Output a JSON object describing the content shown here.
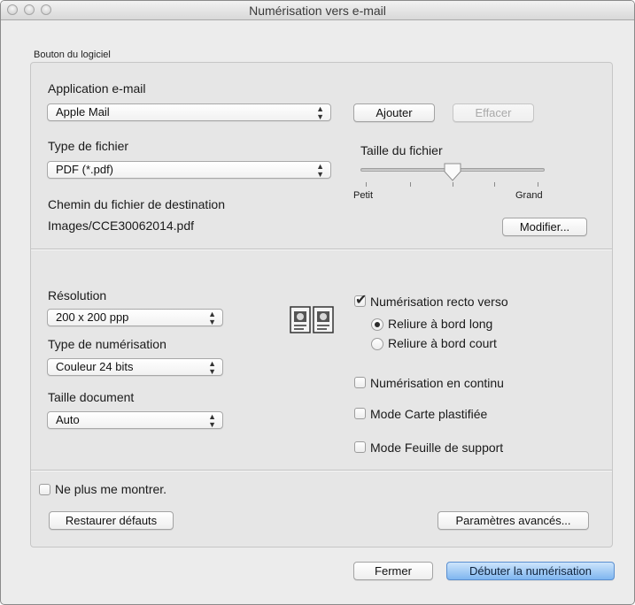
{
  "window": {
    "title": "Numérisation vers e-mail"
  },
  "group": {
    "label": "Bouton du logiciel"
  },
  "email_app": {
    "label": "Application e-mail",
    "value": "Apple Mail",
    "add_button": "Ajouter",
    "delete_button": "Effacer"
  },
  "file_type": {
    "label": "Type de fichier",
    "value": "PDF (*.pdf)"
  },
  "file_size": {
    "label": "Taille du fichier",
    "min_label": "Petit",
    "max_label": "Grand",
    "level_percent": 50
  },
  "destination": {
    "label": "Chemin du fichier de destination",
    "path": "Images/CCE30062014.pdf",
    "modify_button": "Modifier..."
  },
  "resolution": {
    "label": "Résolution",
    "value": "200 x 200 ppp"
  },
  "scan_type": {
    "label": "Type de numérisation",
    "value": "Couleur 24 bits"
  },
  "doc_size": {
    "label": "Taille document",
    "value": "Auto"
  },
  "duplex": {
    "label": "Numérisation recto verso",
    "checked": true,
    "long_edge": "Reliure à bord long",
    "short_edge": "Reliure à bord court",
    "selected": "long_edge"
  },
  "options": {
    "continuous": "Numérisation en continu",
    "plastic_card": "Mode Carte plastifiée",
    "carrier_sheet": "Mode Feuille de support"
  },
  "dont_show": {
    "label": "Ne plus me montrer."
  },
  "buttons": {
    "restore": "Restaurer défauts",
    "advanced": "Paramètres avancés...",
    "close": "Fermer",
    "start": "Débuter la numérisation"
  },
  "icons": {
    "popup_arrows": "up-down-chevron-icon",
    "duplex": "duplex-scan-icon"
  },
  "colors": {
    "primary_button": "#7fb6f0",
    "window_bg": "#ececec"
  }
}
